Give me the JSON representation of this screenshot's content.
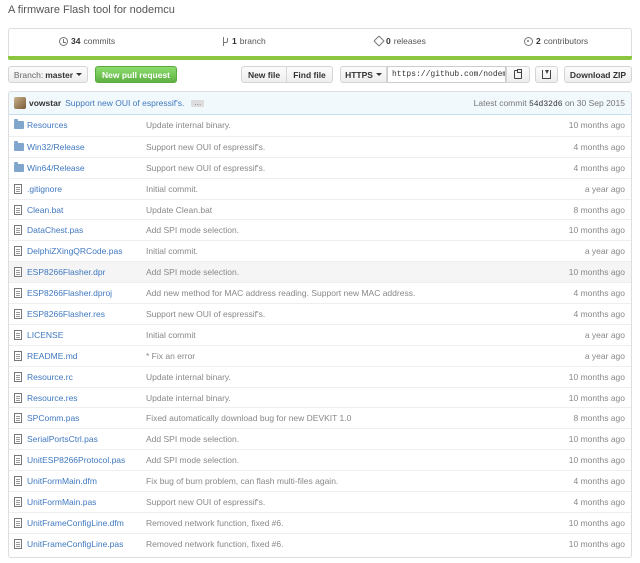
{
  "repo": {
    "description": "A firmware Flash tool for nodemcu"
  },
  "summary": {
    "commits_count": "34",
    "commits_label": "commits",
    "branch_count": "1",
    "branch_label": "branch",
    "releases_count": "0",
    "releases_label": "releases",
    "contributors_count": "2",
    "contributors_label": "contributors",
    "bar_color": "#8cc63f"
  },
  "toolbar": {
    "branch_prefix": "Branch:",
    "branch_name": "master",
    "new_pr": "New pull request",
    "new_file": "New file",
    "find_file": "Find file",
    "protocol": "HTTPS",
    "clone_url": "https://github.com/nodemc",
    "download_zip": "Download ZIP"
  },
  "latest_commit": {
    "author": "vowstar",
    "message": "Support new OUI of espressif's.",
    "ellipsis": "…",
    "label": "Latest commit",
    "sha": "54d32d6",
    "on": "on",
    "date": "30 Sep 2015"
  },
  "files": [
    {
      "type": "dir",
      "name": "Resources",
      "message": "Update internal binary.",
      "age": "10 months ago"
    },
    {
      "type": "dir",
      "name": "Win32/Release",
      "message": "Support new OUI of espressif's.",
      "age": "4 months ago"
    },
    {
      "type": "dir",
      "name": "Win64/Release",
      "message": "Support new OUI of espressif's.",
      "age": "4 months ago"
    },
    {
      "type": "file",
      "name": ".gitignore",
      "message": "Initial commit.",
      "age": "a year ago"
    },
    {
      "type": "file",
      "name": "Clean.bat",
      "message": "Update Clean.bat",
      "age": "8 months ago"
    },
    {
      "type": "file",
      "name": "DataChest.pas",
      "message": "Add SPI mode selection.",
      "age": "10 months ago"
    },
    {
      "type": "file",
      "name": "DelphiZXingQRCode.pas",
      "message": "Initial commit.",
      "age": "a year ago"
    },
    {
      "type": "file",
      "name": "ESP8266Flasher.dpr",
      "message": "Add SPI mode selection.",
      "age": "10 months ago"
    },
    {
      "type": "file",
      "name": "ESP8266Flasher.dproj",
      "message": "Add new method for MAC address reading. Support new MAC address.",
      "age": "4 months ago"
    },
    {
      "type": "file",
      "name": "ESP8266Flasher.res",
      "message": "Support new OUI of espressif's.",
      "age": "4 months ago"
    },
    {
      "type": "file",
      "name": "LICENSE",
      "message": "Initial commit",
      "age": "a year ago"
    },
    {
      "type": "file",
      "name": "README.md",
      "message": "* Fix an error",
      "age": "a year ago"
    },
    {
      "type": "file",
      "name": "Resource.rc",
      "message": "Update internal binary.",
      "age": "10 months ago"
    },
    {
      "type": "file",
      "name": "Resource.res",
      "message": "Update internal binary.",
      "age": "10 months ago"
    },
    {
      "type": "file",
      "name": "SPComm.pas",
      "message": "Fixed automatically download bug for new DEVKIT 1.0",
      "age": "8 months ago"
    },
    {
      "type": "file",
      "name": "SerialPortsCtrl.pas",
      "message": "Add SPI mode selection.",
      "age": "10 months ago"
    },
    {
      "type": "file",
      "name": "UnitESP8266Protocol.pas",
      "message": "Add SPI mode selection.",
      "age": "10 months ago"
    },
    {
      "type": "file",
      "name": "UnitFormMain.dfm",
      "message": "Fix bug of burn problem, can flash multi-files again.",
      "age": "4 months ago"
    },
    {
      "type": "file",
      "name": "UnitFormMain.pas",
      "message": "Support new OUI of espressif's.",
      "age": "4 months ago"
    },
    {
      "type": "file",
      "name": "UnitFrameConfigLine.dfm",
      "message": "Removed network function, fixed #6.",
      "age": "10 months ago"
    },
    {
      "type": "file",
      "name": "UnitFrameConfigLine.pas",
      "message": "Removed network function, fixed #6.",
      "age": "10 months ago"
    }
  ]
}
